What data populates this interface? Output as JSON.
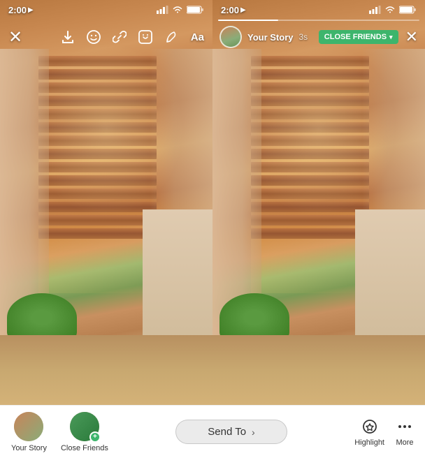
{
  "left_screen": {
    "status": {
      "time": "2:00",
      "time_arrow": "▶"
    },
    "toolbar": {
      "close_label": "×",
      "download_label": "⬇",
      "emoji_label": "😊",
      "link_label": "🔗",
      "sticker_label": "📎",
      "draw_label": "✏",
      "text_label": "Aa"
    }
  },
  "right_screen": {
    "status": {
      "time": "2:00",
      "time_arrow": "▶"
    },
    "header": {
      "username": "Your Story",
      "time_ago": "3s",
      "close_friends_label": "CLOSE FRIENDS",
      "close_friends_chevron": "▾"
    }
  },
  "bottom_bar": {
    "your_story_label": "Your Story",
    "close_friends_label": "Close Friends",
    "send_to_label": "Send To",
    "send_to_arrow": "›",
    "highlight_label": "Highlight",
    "more_label": "More"
  }
}
